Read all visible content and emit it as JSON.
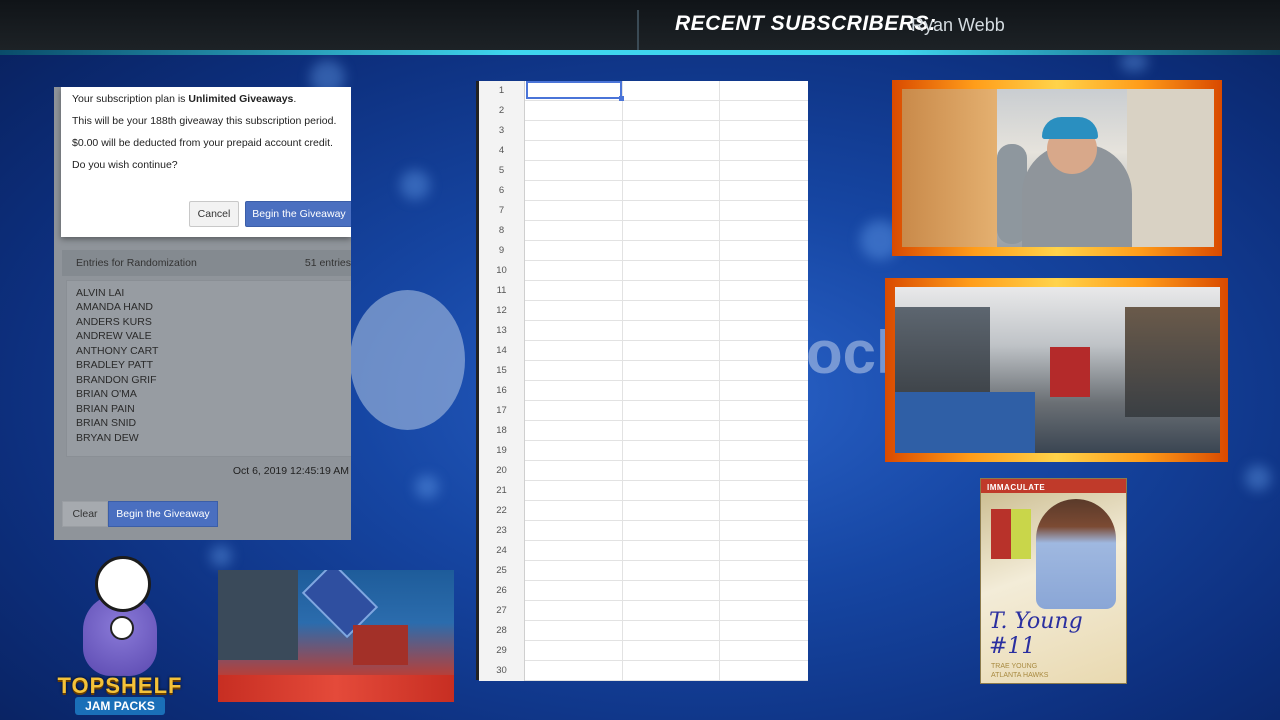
{
  "header": {
    "title": "RECENT SUBSCRIBERS:",
    "subscriber": "Ryan Webb"
  },
  "randomizer": {
    "dialog": {
      "line1_prefix": "Your subscription plan is ",
      "line1_bold": "Unlimited Giveaways",
      "line1_suffix": ".",
      "line2": "This will be your 188th giveaway this subscription period.",
      "line3": "$0.00 will be deducted from your prepaid account credit.",
      "line4": "Do you wish continue?",
      "cancel_label": "Cancel",
      "confirm_label": "Begin the Giveaway"
    },
    "entries_title": "Entries for Randomization",
    "entries_count": "51 entries",
    "entries": [
      "ALVIN LAI",
      "AMANDA HAND",
      "ANDERS KURS",
      "ANDREW VALE",
      "ANTHONY CART",
      "BRADLEY PATT",
      "BRANDON GRIF",
      "BRIAN O'MA",
      "BRIAN PAIN",
      "BRIAN SNID",
      "BRYAN DEW"
    ],
    "timestamp": "Oct 6, 2019 12:45:19 AM",
    "clear_label": "Clear",
    "begin_label": "Begin the Giveaway"
  },
  "spreadsheet": {
    "rows": [
      "1",
      "2",
      "3",
      "4",
      "5",
      "6",
      "7",
      "8",
      "9",
      "10",
      "11",
      "12",
      "13",
      "14",
      "15",
      "16",
      "17",
      "18",
      "19",
      "20",
      "21",
      "22",
      "23",
      "24",
      "25",
      "26",
      "27",
      "28",
      "29",
      "30"
    ]
  },
  "watermark": {
    "fragment": "ocl"
  },
  "card": {
    "brand": "IMMACULATE",
    "signature": "T. Young #11",
    "player": "TRAE YOUNG",
    "team": "ATLANTA HAWKS"
  },
  "logo": {
    "name": "TOPSHELF",
    "sub": "JAM PACKS"
  },
  "colors": {
    "accent_cyan": "#3fd6ee",
    "button_blue": "#4a6fc0",
    "selection_blue": "#4a74d8",
    "cam_frame_orange": "#ff9d1a"
  }
}
